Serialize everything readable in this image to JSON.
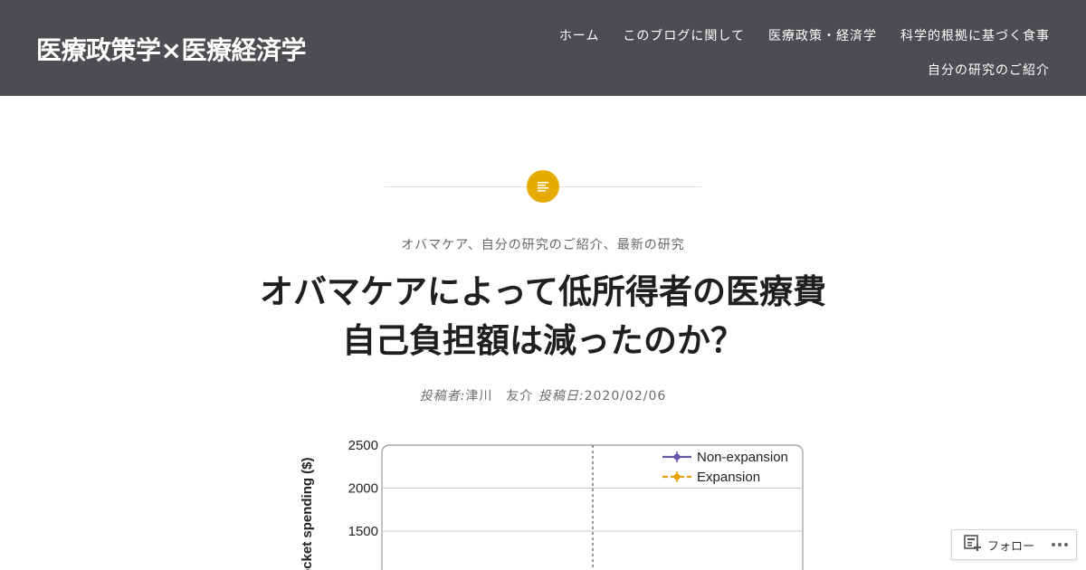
{
  "header": {
    "site_title": "医療政策学×医療経済学",
    "nav": [
      {
        "label": "ホーム"
      },
      {
        "label": "このブログに関して"
      },
      {
        "label": "医療政策・経済学"
      },
      {
        "label": "科学的根拠に基づく食事"
      },
      {
        "label": "自分の研究のご紹介"
      }
    ]
  },
  "post": {
    "format_icon": "standard-post-icon",
    "categories": {
      "items": [
        "オバマケア",
        "自分の研究のご紹介",
        "最新の研究"
      ],
      "separator": "、"
    },
    "title_line1": "オバマケアによって低所得者の医療費",
    "title_line2": "自己負担額は減ったのか？",
    "meta": {
      "author_label": "投稿者:",
      "author": "津川　友介",
      "date_label": "投稿日:",
      "date": "2020/02/06"
    }
  },
  "chart_data": {
    "type": "line",
    "ylabel": "ocket spending ($)",
    "yticks": [
      2500,
      2000,
      1500
    ],
    "series": [
      {
        "name": "Non-expansion",
        "color": "#6b57a8"
      },
      {
        "name": "Expansion",
        "color": "#e5a100"
      }
    ],
    "grid": true,
    "legend": "top-right",
    "reference_line": "dashed-vertical"
  },
  "follow_widget": {
    "label": "フォロー",
    "icon": "follow-icon",
    "more_icon": "more-dots-icon"
  },
  "colors": {
    "header_bg": "#4c4d50",
    "accent": "#e5ab00"
  }
}
